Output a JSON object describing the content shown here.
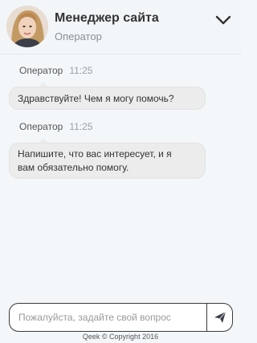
{
  "header": {
    "title": "Менеджер сайта",
    "subtitle": "Оператор",
    "avatar_icon": "operator-avatar",
    "collapse_icon": "chevron-down-icon"
  },
  "messages": [
    {
      "author": "Оператор",
      "time": "11:25",
      "text": "Здравствуйте! Чем я могу помочь?"
    },
    {
      "author": "Оператор",
      "time": "11:25",
      "text_lines": [
        "Напишите, что вас интересует, и я",
        "вам обязательно помогу."
      ]
    }
  ],
  "composer": {
    "placeholder": "Пожалуйста, задайте свой вопрос",
    "value": "",
    "send_icon": "send-icon"
  },
  "footer": {
    "copyright": "Qeek © Copyright 2016"
  },
  "colors": {
    "background": "#f4f7fa",
    "bubble": "#ececec",
    "border": "#3a3a3a"
  }
}
